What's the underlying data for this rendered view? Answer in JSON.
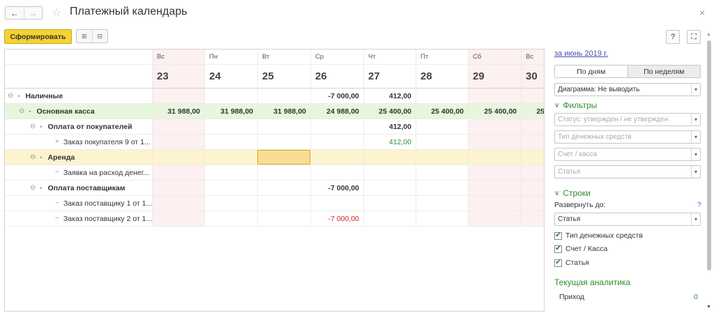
{
  "window": {
    "title": "Платежный календарь",
    "back_icon": "←",
    "forward_icon": "→",
    "star_icon": "☆",
    "close_icon": "×"
  },
  "toolbar": {
    "generate_label": "Сформировать",
    "icon1": "⊞",
    "icon2": "⊟",
    "help_label": "?",
    "expand_icon": "⛶"
  },
  "grid": {
    "days": [
      {
        "weekday": "Вс",
        "num": "23"
      },
      {
        "weekday": "Пн",
        "num": "24"
      },
      {
        "weekday": "Вт",
        "num": "25"
      },
      {
        "weekday": "Ср",
        "num": "26"
      },
      {
        "weekday": "Чт",
        "num": "27"
      },
      {
        "weekday": "Пт",
        "num": "28"
      },
      {
        "weekday": "Сб",
        "num": "29"
      },
      {
        "weekday": "Вс",
        "num": "30"
      }
    ],
    "rows": [
      {
        "toggle": "⊖",
        "label": "Наличные",
        "bold": true,
        "vals": [
          "",
          "",
          "",
          "-7 000,00",
          "412,00",
          "",
          "",
          ""
        ]
      },
      {
        "toggle": "⊖",
        "label": "Основная касса",
        "bold": true,
        "vals": [
          "31 988,00",
          "31 988,00",
          "31 988,00",
          "24 988,00",
          "25 400,00",
          "25 400,00",
          "25 400,00",
          "25"
        ]
      },
      {
        "toggle": "⊖",
        "label": "Оплата от покупателей",
        "bold": true,
        "vals": [
          "",
          "",
          "",
          "",
          "412,00",
          "",
          "",
          ""
        ]
      },
      {
        "toggle": "+",
        "label": "Заказ покупателя 9 от 1...",
        "bold": false,
        "vals": [
          "",
          "",
          "",
          "",
          "412,00",
          "",
          "",
          ""
        ]
      },
      {
        "toggle": "⊖",
        "label": "Аренда",
        "bold": true,
        "vals": [
          "",
          "",
          "",
          "",
          "",
          "",
          "",
          ""
        ]
      },
      {
        "toggle": "−",
        "label": "Заявка на расход денег...",
        "bold": false,
        "vals": [
          "",
          "",
          "",
          "",
          "",
          "",
          "",
          ""
        ]
      },
      {
        "toggle": "⊖",
        "label": "Оплата поставщикам",
        "bold": true,
        "vals": [
          "",
          "",
          "",
          "-7 000,00",
          "",
          "",
          "",
          ""
        ]
      },
      {
        "toggle": "−",
        "label": "Заказ поставщику 1 от 1...",
        "bold": false,
        "vals": [
          "",
          "",
          "",
          "",
          "",
          "",
          "",
          ""
        ]
      },
      {
        "toggle": "−",
        "label": "Заказ поставщику 2 от 1...",
        "bold": false,
        "vals": [
          "",
          "",
          "",
          "-7 000,00",
          "",
          "",
          "",
          ""
        ]
      }
    ],
    "tree_dot": "•"
  },
  "side": {
    "period_link": "за июнь 2019 г.",
    "by_days": "По дням",
    "by_weeks": "По неделям",
    "diagram_value": "Диаграмма: Не выводить",
    "filters_head": "Фильтры",
    "filter_status_ph": "Статус: утвержден / не утвержден",
    "filter_money_type_ph": "Тип денежных средств",
    "filter_account_ph": "Счет / касса",
    "filter_article_ph": "Статья",
    "rows_head": "Строки",
    "expand_to_label": "Развернуть до:",
    "expand_help": "?",
    "expand_to_value": "Статья",
    "check_money_type": "Тип денежных средств",
    "check_account": "Счет / Касса",
    "check_article": "Статья",
    "analytics_head": "Текущая аналитика",
    "income_label": "Приход",
    "income_value": "0",
    "chevron": "∨",
    "dropdown_arrow": "▾",
    "checkmark": "✔"
  }
}
